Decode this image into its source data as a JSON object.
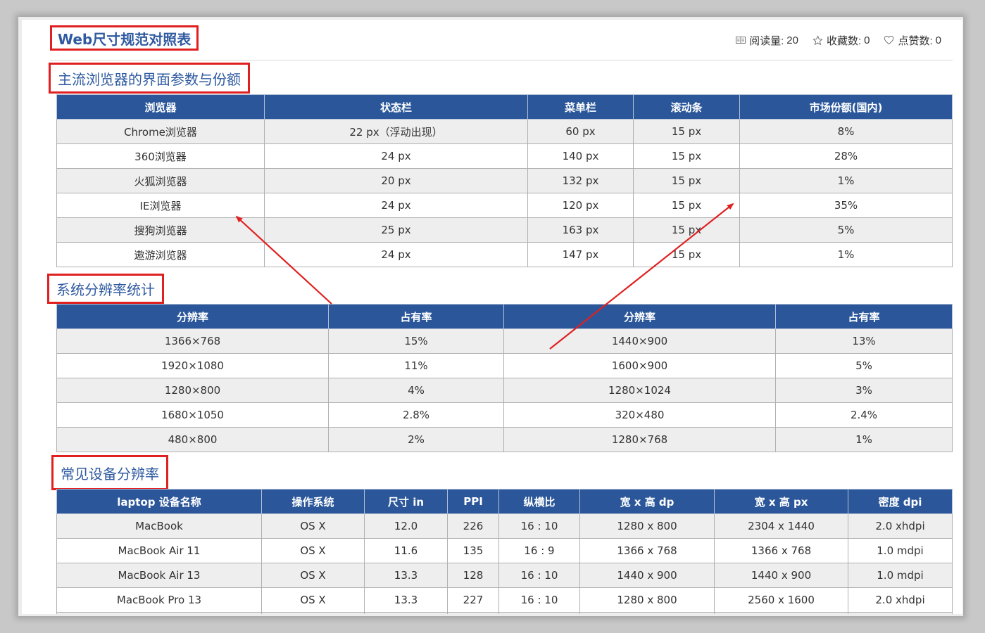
{
  "header": {
    "title": "Web尺寸规范对照表",
    "stats": [
      {
        "icon": "book-icon",
        "label": "阅读量:",
        "value": "20"
      },
      {
        "icon": "star-icon",
        "label": "收藏数:",
        "value": "0"
      },
      {
        "icon": "heart-icon",
        "label": "点赞数:",
        "value": "0"
      }
    ]
  },
  "sections": {
    "browsers": {
      "title": "主流浏览器的界面参数与份额",
      "headers": [
        "浏览器",
        "状态栏",
        "菜单栏",
        "滚动条",
        "市场份额(国内)"
      ],
      "rows": [
        [
          "Chrome浏览器",
          "22 px（浮动出现）",
          "60 px",
          "15 px",
          "8%"
        ],
        [
          "360浏览器",
          "24 px",
          "140 px",
          "15 px",
          "28%"
        ],
        [
          "火狐浏览器",
          "20 px",
          "132 px",
          "15 px",
          "1%"
        ],
        [
          "IE浏览器",
          "24 px",
          "120 px",
          "15 px",
          "35%"
        ],
        [
          "搜狗浏览器",
          "25 px",
          "163 px",
          "15 px",
          "5%"
        ],
        [
          "遨游浏览器",
          "24 px",
          "147 px",
          "15 px",
          "1%"
        ]
      ]
    },
    "resolutions": {
      "title": "系统分辨率统计",
      "headers": [
        "分辨率",
        "占有率",
        "分辨率",
        "占有率"
      ],
      "rows": [
        [
          "1366×768",
          "15%",
          "1440×900",
          "13%"
        ],
        [
          "1920×1080",
          "11%",
          "1600×900",
          "5%"
        ],
        [
          "1280×800",
          "4%",
          "1280×1024",
          "3%"
        ],
        [
          "1680×1050",
          "2.8%",
          "320×480",
          "2.4%"
        ],
        [
          "480×800",
          "2%",
          "1280×768",
          "1%"
        ]
      ]
    },
    "devices": {
      "title": "常见设备分辨率",
      "headers": [
        "laptop 设备名称",
        "操作系统",
        "尺寸 in",
        "PPI",
        "纵横比",
        "宽 x 高 dp",
        "宽 x 高 px",
        "密度 dpi"
      ],
      "rows": [
        [
          "MacBook",
          "OS X",
          "12.0",
          "226",
          "16 : 10",
          "1280 x 800",
          "2304 x 1440",
          "2.0 xhdpi"
        ],
        [
          "MacBook Air 11",
          "OS X",
          "11.6",
          "135",
          "16 : 9",
          "1366 x 768",
          "1366 x 768",
          "1.0 mdpi"
        ],
        [
          "MacBook Air 13",
          "OS X",
          "13.3",
          "128",
          "16 : 10",
          "1440 x 900",
          "1440 x 900",
          "1.0 mdpi"
        ],
        [
          "MacBook Pro 13",
          "OS X",
          "13.3",
          "227",
          "16 : 10",
          "1280 x 800",
          "2560 x 1600",
          "2.0 xhdpi"
        ],
        [
          "",
          "",
          "",
          "",
          "",
          "",
          "",
          ""
        ]
      ]
    }
  },
  "colors": {
    "header_bg": "#2b579a",
    "title_text": "#2f5aa0",
    "highlight_border": "#e02020",
    "arrow": "#e02020",
    "odd_row": "#eeeeee"
  }
}
